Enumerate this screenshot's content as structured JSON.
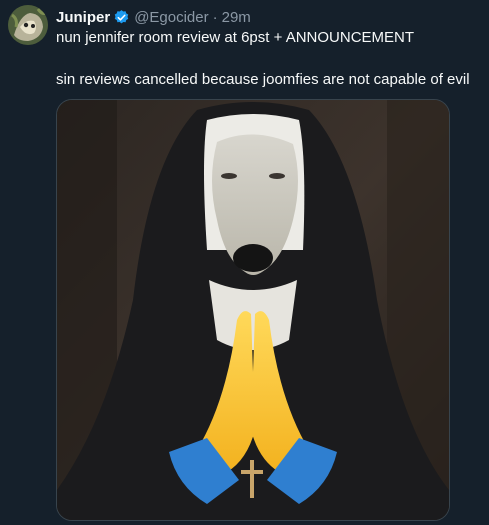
{
  "author": {
    "display_name": "Juniper",
    "handle": "@Egocider",
    "separator": "·",
    "time": "29m",
    "verified_color": "#1d9bf0"
  },
  "post": {
    "line1": "nun jennifer room review at 6pst + ANNOUNCEMENT",
    "line2": "sin reviews cancelled because joomfies are not capable of evil"
  },
  "icons": {
    "verified": "verified-badge-icon",
    "emoji": "folded-hands-emoji"
  },
  "colors": {
    "background": "#15202b",
    "text_primary": "#f7f9f9",
    "text_secondary": "#8b98a5",
    "border": "#38444d",
    "habit": "#1b1b1d",
    "emoji_yellow": "#f9c22e",
    "emoji_sleeve": "#2f7fd0"
  }
}
